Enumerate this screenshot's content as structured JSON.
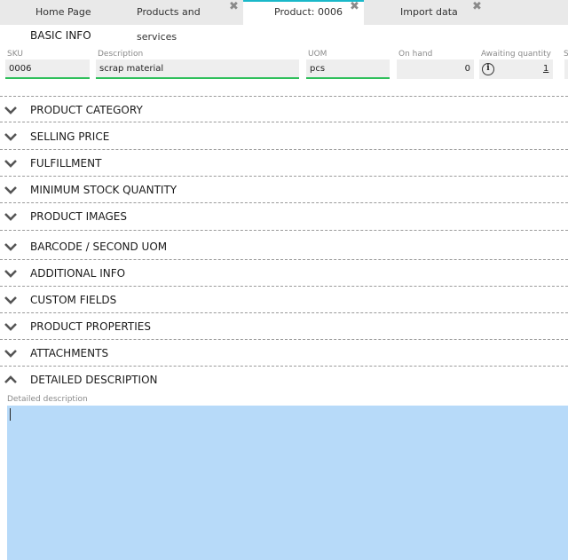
{
  "tabs": [
    {
      "label": "Home Page",
      "closable": false
    },
    {
      "label": "Products and services",
      "closable": true
    },
    {
      "label": "Product: 0006",
      "closable": true,
      "active": true
    },
    {
      "label": "Import data",
      "closable": true
    }
  ],
  "basic_info": {
    "title": "BASIC INFO",
    "sku": {
      "label": "SKU",
      "value": "0006"
    },
    "description": {
      "label": "Description",
      "value": "scrap material"
    },
    "uom": {
      "label": "UOM",
      "value": "pcs"
    },
    "on_hand": {
      "label": "On hand",
      "value": "0"
    },
    "awaiting": {
      "label": "Awaiting quantity",
      "value": "1"
    },
    "cut_label": "S"
  },
  "sections": [
    {
      "label": "PRODUCT CATEGORY",
      "expanded": false
    },
    {
      "label": "SELLING PRICE",
      "expanded": false
    },
    {
      "label": "FULFILLMENT",
      "expanded": false
    },
    {
      "label": "MINIMUM STOCK QUANTITY",
      "expanded": false
    },
    {
      "label": "PRODUCT IMAGES",
      "expanded": false
    },
    {
      "label": "BARCODE / SECOND UOM",
      "expanded": false
    },
    {
      "label": "ADDITIONAL INFO",
      "expanded": false
    },
    {
      "label": "CUSTOM FIELDS",
      "expanded": false
    },
    {
      "label": "PRODUCT PROPERTIES",
      "expanded": false
    },
    {
      "label": "ATTACHMENTS",
      "expanded": false
    },
    {
      "label": "DETAILED DESCRIPTION",
      "expanded": true
    }
  ],
  "detailed_description": {
    "label": "Detailed description",
    "value": ""
  },
  "colors": {
    "accent": "#1ab8c9",
    "valid": "#2ebf5a",
    "textarea_bg": "#b7daf9"
  },
  "icons": {
    "expand": "chevron-down-icon",
    "collapse": "chevron-up-icon",
    "close": "close-icon",
    "info": "info-icon"
  }
}
